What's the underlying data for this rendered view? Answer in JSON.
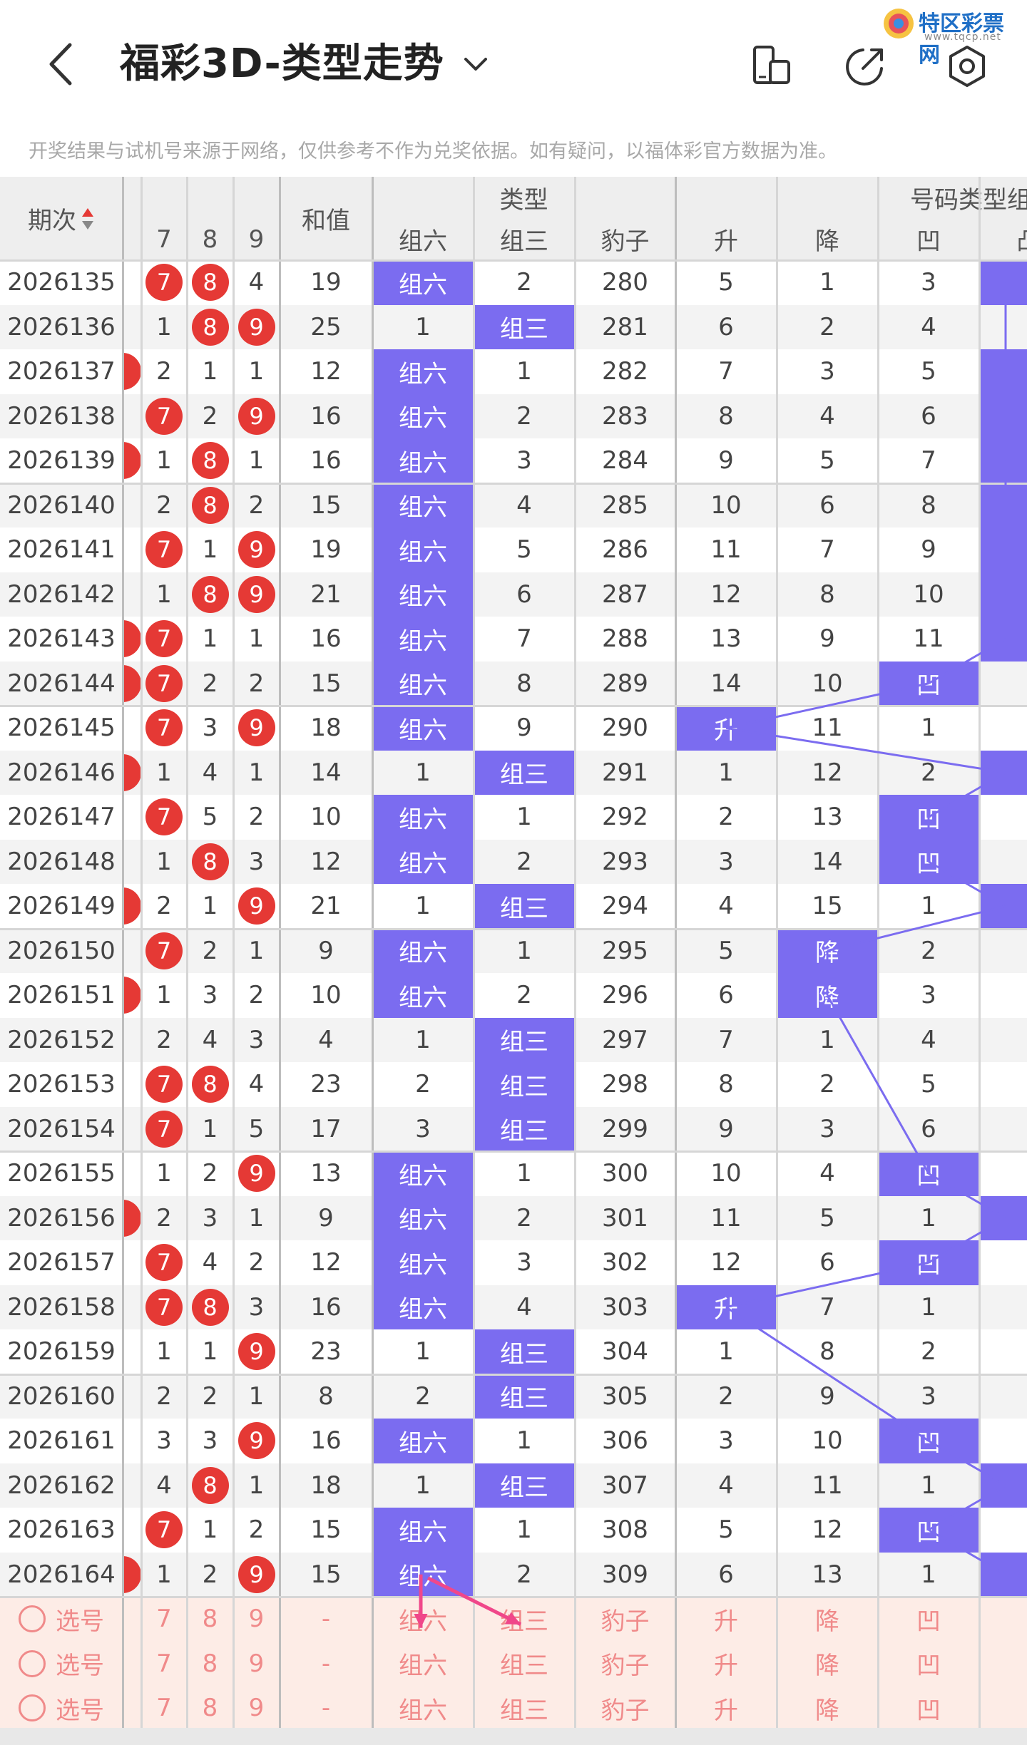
{
  "header": {
    "title": "福彩3D-类型走势",
    "logo_text": "特区彩票网",
    "logo_sub": "www.tqcp.net"
  },
  "notice": "开奖结果与试机号来源于网络，仅供参考不作为兑奖依据。如有疑问，以福体彩官方数据为准。",
  "table": {
    "headers": {
      "period": "期次",
      "digits": [
        "7",
        "8",
        "9"
      ],
      "sum": "和值",
      "type_group": "类型",
      "types": [
        "组六",
        "组三",
        "豹子"
      ],
      "code_group": "号码类型组",
      "codes": [
        "升",
        "降",
        "凹",
        "凸"
      ]
    },
    "rows": [
      {
        "p": "2026135",
        "e": false,
        "d": [
          "b7",
          "b8",
          "4"
        ],
        "s": "19",
        "t": [
          "组六",
          "2",
          "280"
        ],
        "u": [
          "5",
          "1",
          "3"
        ],
        "v": true
      },
      {
        "p": "2026136",
        "e": false,
        "d": [
          "1",
          "b8",
          "b9"
        ],
        "s": "25",
        "t": [
          "1",
          "组三",
          "281"
        ],
        "u": [
          "6",
          "2",
          "4"
        ],
        "v": false
      },
      {
        "p": "2026137",
        "e": true,
        "d": [
          "2",
          "1",
          "1"
        ],
        "s": "12",
        "t": [
          "组六",
          "1",
          "282"
        ],
        "u": [
          "7",
          "3",
          "5"
        ],
        "v": true
      },
      {
        "p": "2026138",
        "e": false,
        "d": [
          "b7",
          "2",
          "b9"
        ],
        "s": "16",
        "t": [
          "组六",
          "2",
          "283"
        ],
        "u": [
          "8",
          "4",
          "6"
        ],
        "v": true
      },
      {
        "p": "2026139",
        "e": true,
        "d": [
          "1",
          "b8",
          "1"
        ],
        "s": "16",
        "t": [
          "组六",
          "3",
          "284"
        ],
        "u": [
          "9",
          "5",
          "7"
        ],
        "v": true
      },
      {
        "p": "2026140",
        "e": false,
        "d": [
          "2",
          "b8",
          "2"
        ],
        "s": "15",
        "t": [
          "组六",
          "4",
          "285"
        ],
        "u": [
          "10",
          "6",
          "8"
        ],
        "v": true
      },
      {
        "p": "2026141",
        "e": false,
        "d": [
          "b7",
          "1",
          "b9"
        ],
        "s": "19",
        "t": [
          "组六",
          "5",
          "286"
        ],
        "u": [
          "11",
          "7",
          "9"
        ],
        "v": true
      },
      {
        "p": "2026142",
        "e": false,
        "d": [
          "1",
          "b8",
          "b9"
        ],
        "s": "21",
        "t": [
          "组六",
          "6",
          "287"
        ],
        "u": [
          "12",
          "8",
          "10"
        ],
        "v": true
      },
      {
        "p": "2026143",
        "e": true,
        "d": [
          "b7",
          "1",
          "1"
        ],
        "s": "16",
        "t": [
          "组六",
          "7",
          "288"
        ],
        "u": [
          "13",
          "9",
          "11"
        ],
        "v": true
      },
      {
        "p": "2026144",
        "e": true,
        "d": [
          "b7",
          "2",
          "2"
        ],
        "s": "15",
        "t": [
          "组六",
          "8",
          "289"
        ],
        "u": [
          "14",
          "10",
          "凹"
        ],
        "v": false
      },
      {
        "p": "2026145",
        "e": false,
        "d": [
          "b7",
          "3",
          "b9"
        ],
        "s": "18",
        "t": [
          "组六",
          "9",
          "290"
        ],
        "u": [
          "升",
          "11",
          "1"
        ],
        "v": false
      },
      {
        "p": "2026146",
        "e": true,
        "d": [
          "1",
          "4",
          "1"
        ],
        "s": "14",
        "t": [
          "1",
          "组三",
          "291"
        ],
        "u": [
          "1",
          "12",
          "2"
        ],
        "v": true
      },
      {
        "p": "2026147",
        "e": false,
        "d": [
          "b7",
          "5",
          "2"
        ],
        "s": "10",
        "t": [
          "组六",
          "1",
          "292"
        ],
        "u": [
          "2",
          "13",
          "凹"
        ],
        "v": false
      },
      {
        "p": "2026148",
        "e": false,
        "d": [
          "1",
          "b8",
          "3"
        ],
        "s": "12",
        "t": [
          "组六",
          "2",
          "293"
        ],
        "u": [
          "3",
          "14",
          "凹"
        ],
        "v": false
      },
      {
        "p": "2026149",
        "e": true,
        "d": [
          "2",
          "1",
          "b9"
        ],
        "s": "21",
        "t": [
          "1",
          "组三",
          "294"
        ],
        "u": [
          "4",
          "15",
          "1"
        ],
        "v": true
      },
      {
        "p": "2026150",
        "e": false,
        "d": [
          "b7",
          "2",
          "1"
        ],
        "s": "9",
        "t": [
          "组六",
          "1",
          "295"
        ],
        "u": [
          "5",
          "降",
          "2"
        ],
        "v": false
      },
      {
        "p": "2026151",
        "e": true,
        "d": [
          "1",
          "3",
          "2"
        ],
        "s": "10",
        "t": [
          "组六",
          "2",
          "296"
        ],
        "u": [
          "6",
          "降",
          "3"
        ],
        "v": false
      },
      {
        "p": "2026152",
        "e": false,
        "d": [
          "2",
          "4",
          "3"
        ],
        "s": "4",
        "t": [
          "1",
          "组三",
          "297"
        ],
        "u": [
          "7",
          "1",
          "4"
        ],
        "v": false
      },
      {
        "p": "2026153",
        "e": false,
        "d": [
          "b7",
          "b8",
          "4"
        ],
        "s": "23",
        "t": [
          "2",
          "组三",
          "298"
        ],
        "u": [
          "8",
          "2",
          "5"
        ],
        "v": false
      },
      {
        "p": "2026154",
        "e": false,
        "d": [
          "b7",
          "1",
          "5"
        ],
        "s": "17",
        "t": [
          "3",
          "组三",
          "299"
        ],
        "u": [
          "9",
          "3",
          "6"
        ],
        "v": false
      },
      {
        "p": "2026155",
        "e": false,
        "d": [
          "1",
          "2",
          "b9"
        ],
        "s": "13",
        "t": [
          "组六",
          "1",
          "300"
        ],
        "u": [
          "10",
          "4",
          "凹"
        ],
        "v": false
      },
      {
        "p": "2026156",
        "e": true,
        "d": [
          "2",
          "3",
          "1"
        ],
        "s": "9",
        "t": [
          "组六",
          "2",
          "301"
        ],
        "u": [
          "11",
          "5",
          "1"
        ],
        "v": true
      },
      {
        "p": "2026157",
        "e": false,
        "d": [
          "b7",
          "4",
          "2"
        ],
        "s": "12",
        "t": [
          "组六",
          "3",
          "302"
        ],
        "u": [
          "12",
          "6",
          "凹"
        ],
        "v": false
      },
      {
        "p": "2026158",
        "e": false,
        "d": [
          "b7",
          "b8",
          "3"
        ],
        "s": "16",
        "t": [
          "组六",
          "4",
          "303"
        ],
        "u": [
          "升",
          "7",
          "1"
        ],
        "v": false
      },
      {
        "p": "2026159",
        "e": false,
        "d": [
          "1",
          "1",
          "b9"
        ],
        "s": "23",
        "t": [
          "1",
          "组三",
          "304"
        ],
        "u": [
          "1",
          "8",
          "2"
        ],
        "v": false
      },
      {
        "p": "2026160",
        "e": false,
        "d": [
          "2",
          "2",
          "1"
        ],
        "s": "8",
        "t": [
          "2",
          "组三",
          "305"
        ],
        "u": [
          "2",
          "9",
          "3"
        ],
        "v": false
      },
      {
        "p": "2026161",
        "e": false,
        "d": [
          "3",
          "3",
          "b9"
        ],
        "s": "16",
        "t": [
          "组六",
          "1",
          "306"
        ],
        "u": [
          "3",
          "10",
          "凹"
        ],
        "v": false
      },
      {
        "p": "2026162",
        "e": false,
        "d": [
          "4",
          "b8",
          "1"
        ],
        "s": "18",
        "t": [
          "1",
          "组三",
          "307"
        ],
        "u": [
          "4",
          "11",
          "1"
        ],
        "v": true
      },
      {
        "p": "2026163",
        "e": false,
        "d": [
          "b7",
          "1",
          "2"
        ],
        "s": "15",
        "t": [
          "组六",
          "1",
          "308"
        ],
        "u": [
          "5",
          "12",
          "凹"
        ],
        "v": false
      },
      {
        "p": "2026164",
        "e": true,
        "d": [
          "1",
          "2",
          "b9"
        ],
        "s": "15",
        "t": [
          "组六",
          "2",
          "309"
        ],
        "u": [
          "6",
          "13",
          "1"
        ],
        "v": true
      }
    ],
    "select_rows": [
      {
        "label": "选号",
        "d": [
          "7",
          "8",
          "9"
        ],
        "s": "-",
        "t": [
          "组六",
          "组三",
          "豹子"
        ],
        "u": [
          "升",
          "降",
          "凹"
        ]
      },
      {
        "label": "选号",
        "d": [
          "7",
          "8",
          "9"
        ],
        "s": "-",
        "t": [
          "组六",
          "组三",
          "豹子"
        ],
        "u": [
          "升",
          "降",
          "凹"
        ]
      },
      {
        "label": "选号",
        "d": [
          "7",
          "8",
          "9"
        ],
        "s": "-",
        "t": [
          "组六",
          "组三",
          "豹子"
        ],
        "u": [
          "升",
          "降",
          "凹"
        ]
      }
    ]
  },
  "colors": {
    "accent": "#7b6cf0",
    "ball": "#e53935",
    "select_text": "#f08a8a"
  }
}
